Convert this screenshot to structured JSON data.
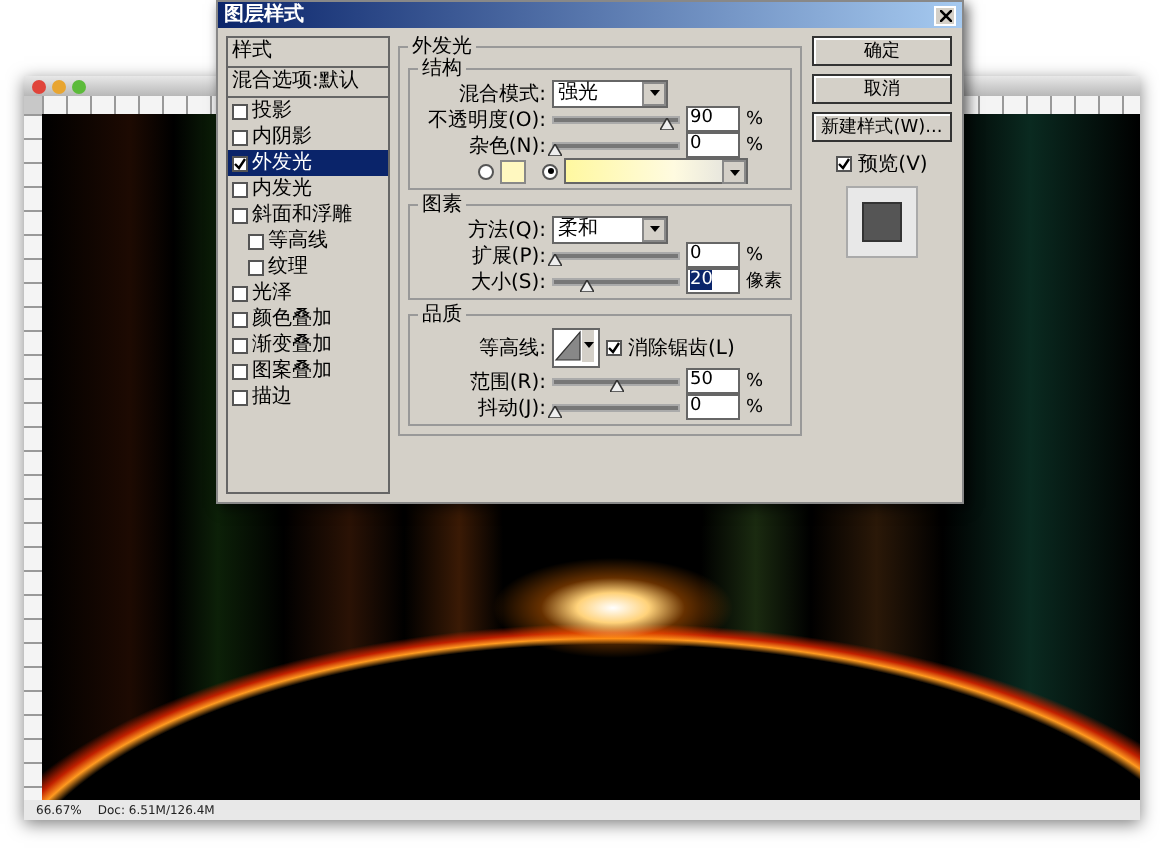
{
  "document": {
    "zoom": "66.67%",
    "doc_size": "Doc: 6.51M/126.4M"
  },
  "dialog": {
    "title": "图层样式",
    "styles_header": "样式",
    "blend_options": "混合选项:默认",
    "styles": [
      {
        "label": "投影",
        "checked": false,
        "selected": false
      },
      {
        "label": "内阴影",
        "checked": false,
        "selected": false
      },
      {
        "label": "外发光",
        "checked": true,
        "selected": true
      },
      {
        "label": "内发光",
        "checked": false,
        "selected": false
      },
      {
        "label": "斜面和浮雕",
        "checked": false,
        "selected": false,
        "children": [
          {
            "label": "等高线",
            "checked": false,
            "selected": false
          },
          {
            "label": "纹理",
            "checked": false,
            "selected": false
          }
        ]
      },
      {
        "label": "光泽",
        "checked": false,
        "selected": false
      },
      {
        "label": "颜色叠加",
        "checked": false,
        "selected": false
      },
      {
        "label": "渐变叠加",
        "checked": false,
        "selected": false
      },
      {
        "label": "图案叠加",
        "checked": false,
        "selected": false
      },
      {
        "label": "描边",
        "checked": false,
        "selected": false
      }
    ],
    "outer_glow": {
      "title": "外发光",
      "structure": {
        "title": "结构",
        "blend_mode_label": "混合模式:",
        "blend_mode": "强光",
        "sliders": [
          {
            "label": "不透明度(O):",
            "level": 0.9,
            "value": "90",
            "unit": "%",
            "selected": false
          },
          {
            "label": "杂色(N):",
            "level": 0,
            "value": "0",
            "unit": "%",
            "selected": false
          }
        ],
        "fill": [
          {
            "kind": "color",
            "selected": false
          },
          {
            "kind": "gradient",
            "selected": true
          }
        ]
      },
      "elements": {
        "title": "图素",
        "method_label": "方法(Q):",
        "method": "柔和",
        "sliders": [
          {
            "label": "扩展(P):",
            "level": 0,
            "value": "0",
            "unit": "%",
            "selected": false
          },
          {
            "label": "大小(S):",
            "level": 0.25,
            "value": "20",
            "unit": "像素",
            "selected": true
          }
        ]
      },
      "quality": {
        "title": "品质",
        "contour_label": "等高线:",
        "anti_alias": {
          "label": "消除锯齿(L)",
          "checked": true
        },
        "sliders": [
          {
            "label": "范围(R):",
            "level": 0.5,
            "value": "50",
            "unit": "%",
            "selected": false
          },
          {
            "label": "抖动(J):",
            "level": 0,
            "value": "0",
            "unit": "%",
            "selected": false
          }
        ]
      }
    },
    "buttons": [
      "确定",
      "取消",
      "新建样式(W)..."
    ],
    "preview": {
      "label": "预览(V)",
      "checked": true
    }
  }
}
